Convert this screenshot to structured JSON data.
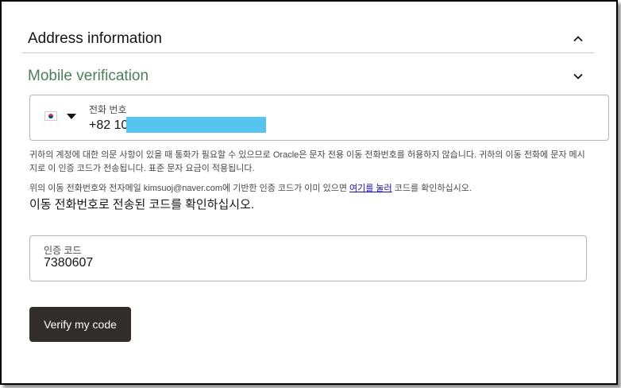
{
  "sections": {
    "address": {
      "title": "Address information",
      "expanded": false
    },
    "mobile": {
      "title": "Mobile verification",
      "expanded": true
    }
  },
  "phone": {
    "country_flag": "south-korea-flag-icon",
    "label": "전화 번호",
    "value_prefix": "+82 10"
  },
  "help": {
    "text1": "귀하의 계정에 대한 의문 사항이 있을 때 통화가 필요할 수 있으므로 Oracle은 문자 전용 이동 전화번호를 허용하지 않습니다. 귀하의 이동 전화에 문자 메시지로 이 인증 코드가 전송됩니다. 표준 문자 요금이 적용됩니다.",
    "text2_before": "위의 이동 전화번호와 전자메일 kimsuoj@naver.com에 기반한 인증 코드가 이미 있으면 ",
    "text2_link": "여기를 눌러",
    "text2_after": " 코드를 확인하십시오."
  },
  "instruction": "이동 전화번호로 전송된 코드를 확인하십시오.",
  "code": {
    "label": "인증 코드",
    "value": "7380607"
  },
  "buttons": {
    "verify": "Verify my code"
  },
  "colors": {
    "mobile_title": "#4f7d5a",
    "button_bg": "#312d2a",
    "link": "#1a0dab",
    "redaction": "#55c4f0"
  }
}
